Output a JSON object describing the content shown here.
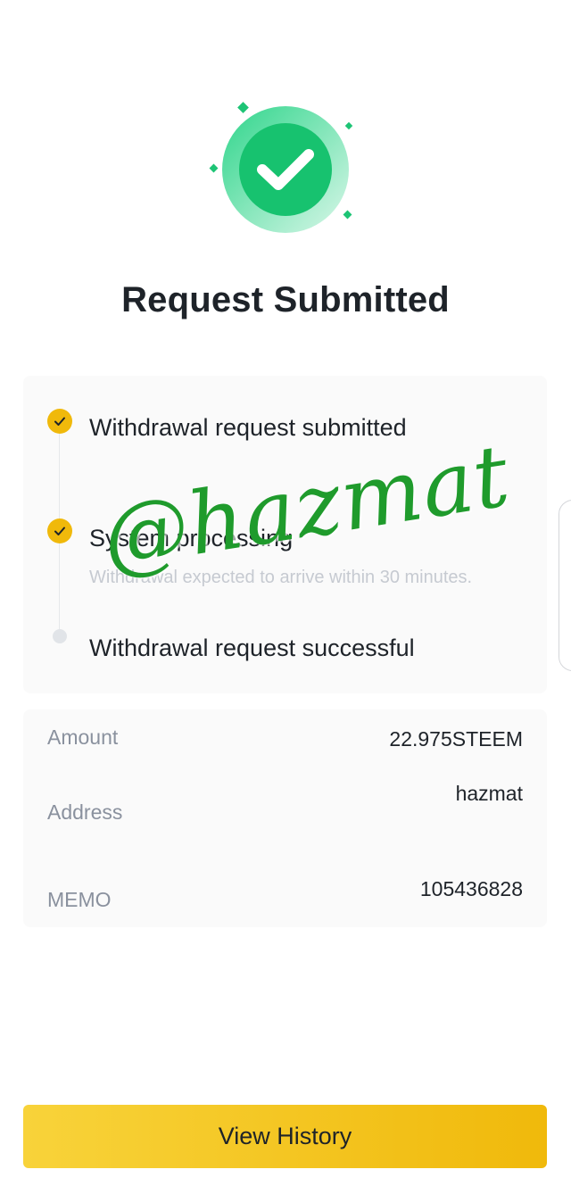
{
  "header": {
    "icon": "check-success-icon",
    "title": "Request Submitted"
  },
  "steps": [
    {
      "label": "Withdrawal request submitted",
      "status": "done",
      "sub": ""
    },
    {
      "label": "System processing",
      "status": "done",
      "sub": "Withdrawal expected to arrive within 30 minutes."
    },
    {
      "label": "Withdrawal request successful",
      "status": "pending",
      "sub": ""
    }
  ],
  "details": {
    "amount_label": "Amount",
    "amount_value": "22.975STEEM",
    "address_label": "Address",
    "address_value": "hazmat",
    "memo_label": "MEMO",
    "memo_value": "105436828"
  },
  "watermark": "@hazmat",
  "actions": {
    "view_history": "View History"
  },
  "colors": {
    "success": "#1dc475",
    "accent": "#f0b90b",
    "watermark": "#1f9b2c"
  }
}
